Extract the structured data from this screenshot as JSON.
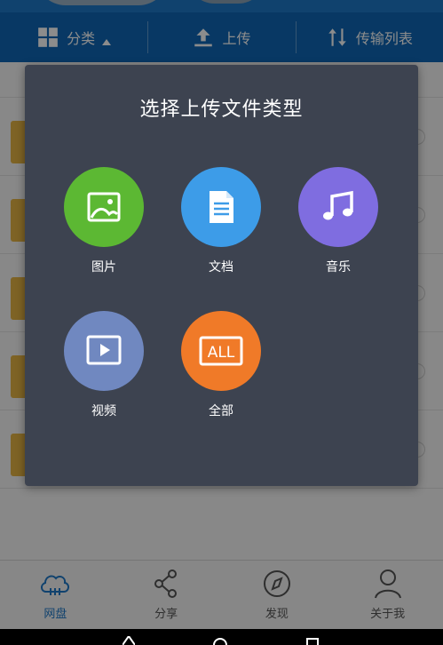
{
  "toolbar": {
    "category_label": "分类",
    "upload_label": "上传",
    "transfer_label": "传输列表"
  },
  "dialog": {
    "title": "选择上传文件类型",
    "types": [
      {
        "label": "图片",
        "icon": "image-icon",
        "color": "#5cb833"
      },
      {
        "label": "文档",
        "icon": "document-icon",
        "color": "#3d9ce8"
      },
      {
        "label": "音乐",
        "icon": "music-icon",
        "color": "#7f6de0"
      },
      {
        "label": "视频",
        "icon": "video-icon",
        "color": "#7088c0"
      },
      {
        "label": "全部",
        "icon": "all-icon",
        "color": "#f07a28"
      }
    ],
    "all_icon_text": "ALL"
  },
  "tabs": [
    {
      "label": "网盘",
      "icon": "cloud-icon",
      "active": true
    },
    {
      "label": "分享",
      "icon": "share-icon",
      "active": false
    },
    {
      "label": "发现",
      "icon": "compass-icon",
      "active": false
    },
    {
      "label": "关于我",
      "icon": "person-icon",
      "active": false
    }
  ],
  "colors": {
    "primary": "#0f67b6",
    "dialog_bg": "#3d4350",
    "folder": "#e6b544"
  }
}
